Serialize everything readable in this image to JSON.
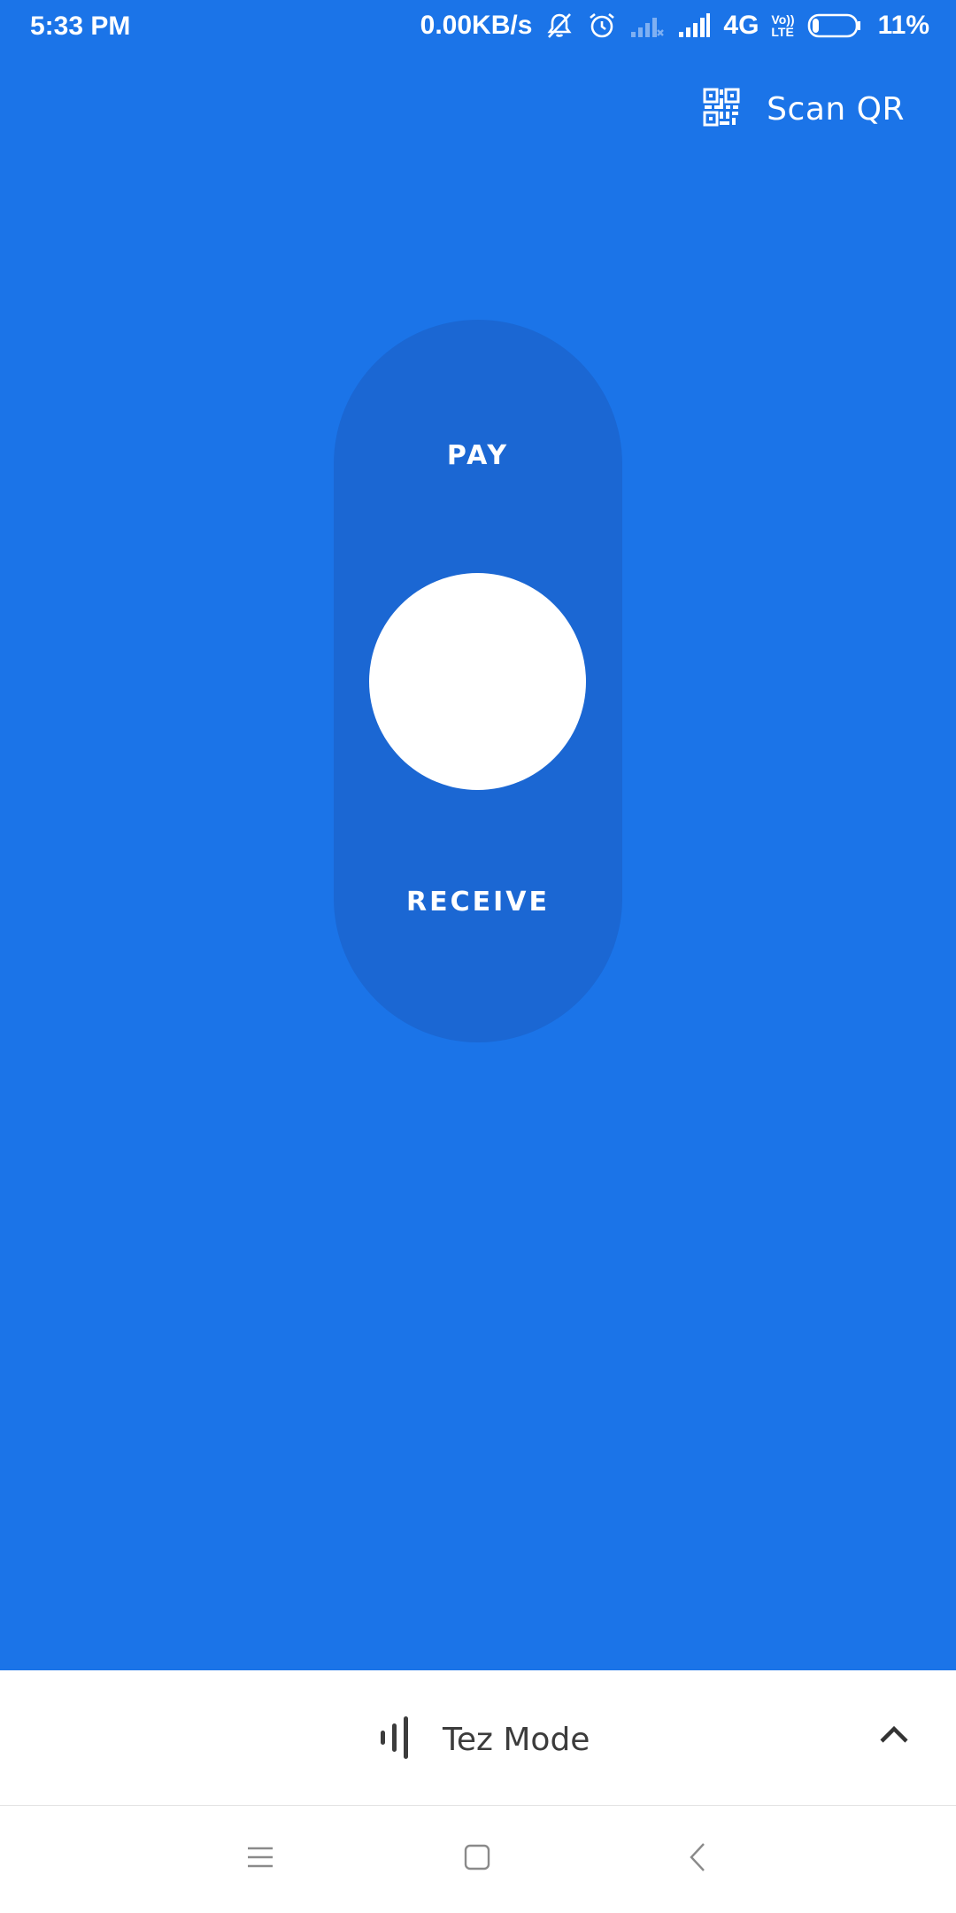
{
  "status_bar": {
    "time": "5:33 PM",
    "network_speed": "0.00KB/s",
    "network_type": "4G",
    "volte_top": "Vo))",
    "volte_bottom": "LTE",
    "battery_percent": "11%",
    "icons": [
      "mute-icon",
      "alarm-icon",
      "signal-weak-icon",
      "signal-icon",
      "battery-icon"
    ]
  },
  "header": {
    "scan_qr_label": "Scan QR",
    "scan_qr_icon": "qr-code-icon"
  },
  "slider": {
    "pay_label": "PAY",
    "receive_label": "RECEIVE"
  },
  "mode_bar": {
    "label": "Tez Mode",
    "icon": "audio-bars-icon",
    "expand_icon": "chevron-up-icon"
  },
  "nav_bar": {
    "icons": [
      "menu-icon",
      "home-icon",
      "back-icon"
    ]
  },
  "colors": {
    "background": "#1b74e8",
    "pill": "#1b67d3",
    "white": "#ffffff",
    "mode_text": "#3c3c3c"
  }
}
